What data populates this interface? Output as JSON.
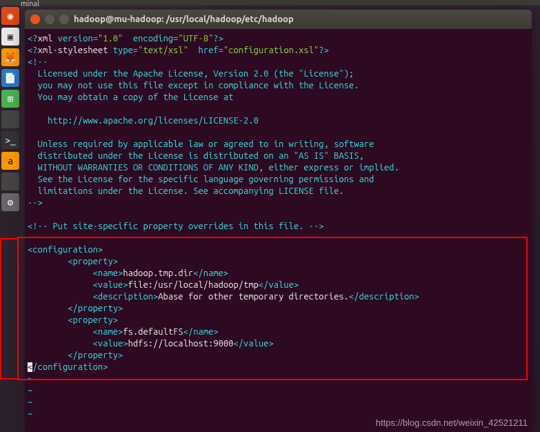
{
  "top_bar_text": "minal",
  "launcher": {
    "items": [
      {
        "name": "ubuntu",
        "glyph": "◉"
      },
      {
        "name": "files",
        "glyph": "▣"
      },
      {
        "name": "firefox",
        "glyph": "🦊"
      },
      {
        "name": "writer",
        "glyph": "📄"
      },
      {
        "name": "calc",
        "glyph": "⊞"
      },
      {
        "name": "blank1",
        "glyph": ""
      },
      {
        "name": "terminal",
        "glyph": ">_"
      },
      {
        "name": "amazon",
        "glyph": "a"
      },
      {
        "name": "blank2",
        "glyph": ""
      },
      {
        "name": "gear",
        "glyph": "⚙"
      }
    ]
  },
  "window": {
    "title": "hadoop@mu-hadoop: /usr/local/hadoop/etc/hadoop"
  },
  "xml": {
    "version": "1.0",
    "encoding": "UTF-8",
    "stylesheet_type": "text/xsl",
    "stylesheet_href": "configuration.xsl"
  },
  "license_lines": [
    "<!--",
    "  Licensed under the Apache License, Version 2.0 (the \"License\");",
    "  you may not use this file except in compliance with the License.",
    "  You may obtain a copy of the License at",
    "",
    "    http://www.apache.org/licenses/LICENSE-2.0",
    "",
    "  Unless required by applicable law or agreed to in writing, software",
    "  distributed under the License is distributed on an \"AS IS\" BASIS,",
    "  WITHOUT WARRANTIES OR CONDITIONS OF ANY KIND, either express or implied.",
    "  See the License for the specific language governing permissions and",
    "  limitations under the License. See accompanying LICENSE file.",
    "-->",
    "",
    "<!-- Put site-specific property overrides in this file. -->",
    ""
  ],
  "config": {
    "open_tag": "<configuration>",
    "close_tag": "/configuration>",
    "properties": [
      {
        "prop_open": "<property>",
        "name_open": "<name>",
        "name_val": "hadoop.tmp.dir",
        "name_close": "</name>",
        "value_open": "<value>",
        "value_val": "file:/usr/local/hadoop/tmp",
        "value_close": "</value>",
        "desc_open": "<description>",
        "desc_val": "Abase for other temporary directories.",
        "desc_close": "</description>",
        "prop_close": "</property>"
      },
      {
        "prop_open": "<property>",
        "name_open": "<name>",
        "name_val": "fs.defaultFS",
        "name_close": "</name>",
        "value_open": "<value>",
        "value_val": "hdfs://localhost:9000",
        "value_close": "</value>",
        "prop_close": "</property>"
      }
    ]
  },
  "xml_lit": {
    "lt_q": "<?",
    "xml_word": "xml",
    "sp_version_eq": " version=",
    "q1": "\"",
    "sp_encoding_eq": "  encoding=",
    "q_gt": "?>",
    "stylesheet_word": "xml-stylesheet",
    "sp_type_eq": " type=",
    "sp_href_eq": "  href=",
    "lt": "<"
  },
  "tilde": "~",
  "watermark": "https://blog.csdn.net/weixin_42521211"
}
